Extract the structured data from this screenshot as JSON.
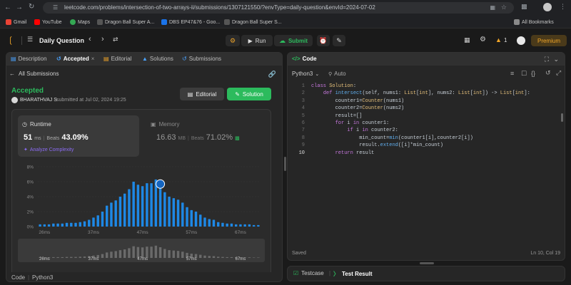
{
  "browser": {
    "url": "leetcode.com/problems/intersection-of-two-arrays-ii/submissions/1307121550/?envType=daily-question&envId=2024-07-02",
    "bookmarks": [
      {
        "label": "Gmail",
        "color": "#ea4335"
      },
      {
        "label": "YouTube",
        "color": "#ff0000"
      },
      {
        "label": "Maps",
        "color": "#34a853"
      },
      {
        "label": "Dragon Ball Super A...",
        "color": "#3a3a3a"
      },
      {
        "label": "DBS EP47&76 - Goo...",
        "color": "#1a73e8"
      },
      {
        "label": "Dragon Ball Super S...",
        "color": "#3a3a3a"
      }
    ],
    "all_bookmarks": "All Bookmarks"
  },
  "header": {
    "title": "Daily Question",
    "run": "Run",
    "submit": "Submit",
    "streak": "1",
    "premium": "Premium"
  },
  "left": {
    "tabs": [
      "Description",
      "Accepted",
      "Editorial",
      "Solutions",
      "Submissions"
    ],
    "back": "All Submissions",
    "status": "Accepted",
    "user": "BHARATHVAJ S",
    "submitted": "submitted at Jul 02, 2024 19:25",
    "editorial_btn": "Editorial",
    "solution_btn": "Solution",
    "runtime": {
      "label": "Runtime",
      "value": "51",
      "unit": "ms",
      "beats_label": "Beats",
      "beats": "43.09%",
      "analyze": "Analyze Complexity"
    },
    "memory": {
      "label": "Memory",
      "value": "16.63",
      "unit": "MB",
      "beats_label": "Beats",
      "beats": "71.02%"
    },
    "footer_code": "Code",
    "footer_lang": "Python3"
  },
  "chart_data": {
    "type": "bar",
    "title": "",
    "ylabel": "",
    "y_ticks": [
      "8%",
      "6%",
      "4%",
      "2%",
      "0%"
    ],
    "x_ticks": [
      "26ms",
      "37ms",
      "47ms",
      "57ms",
      "67ms"
    ],
    "ylim": [
      0,
      8
    ],
    "highlight_x": "51ms",
    "values": [
      0.3,
      0.3,
      0.3,
      0.4,
      0.4,
      0.4,
      0.5,
      0.5,
      0.5,
      0.6,
      0.7,
      0.9,
      1.2,
      1.5,
      2.0,
      2.8,
      3.2,
      3.5,
      4.0,
      4.4,
      5.0,
      6.0,
      5.6,
      5.4,
      5.8,
      5.8,
      6.3,
      5.5,
      4.6,
      4.0,
      3.8,
      3.6,
      3.2,
      2.6,
      2.2,
      2.0,
      1.6,
      1.2,
      1.0,
      0.9,
      0.6,
      0.5,
      0.4,
      0.4,
      0.3,
      0.3,
      0.3,
      0.3,
      0.2,
      0.2
    ]
  },
  "right": {
    "title": "Code",
    "language": "Python3",
    "auto": "Auto",
    "lines": [
      "class Solution:",
      "    def intersect(self, nums1: List[int], nums2: List[int]) -> List[int]:",
      "        counter1=Counter(nums1)",
      "        counter2=Counter(nums2)",
      "        result=[]",
      "        for i in counter1:",
      "            if i in counter2:",
      "                min_count=min(counter1[i],counter2[i])",
      "                result.extend([i]*min_count)",
      "        return result"
    ],
    "saved": "Saved",
    "cursor": "Ln 10, Col 19",
    "testcase": "Testcase",
    "test_result": "Test Result"
  }
}
